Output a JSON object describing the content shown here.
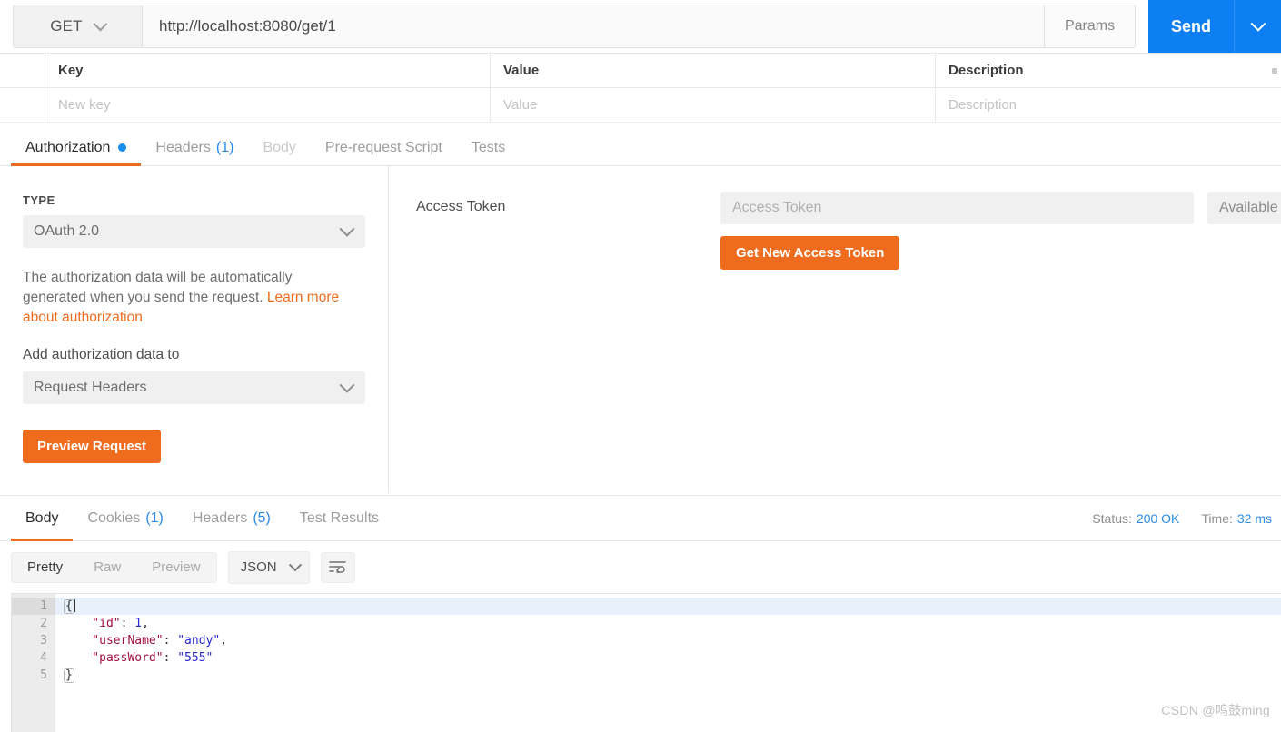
{
  "request": {
    "method": "GET",
    "method_icon": "chevron-down-icon",
    "url": "http://localhost:8080/get/1",
    "params_label": "Params",
    "send_label": "Send",
    "send_caret_icon": "chevron-down-icon"
  },
  "params_table": {
    "headers": [
      "Key",
      "Value",
      "Description"
    ],
    "bulk_icon": "ellipsis-icon",
    "rows": [
      {
        "key": "New key",
        "value": "Value",
        "description": "Description"
      }
    ]
  },
  "request_tabs": [
    {
      "label": "Authorization",
      "active": true,
      "dot": true
    },
    {
      "label": "Headers",
      "count": "(1)",
      "active": false
    },
    {
      "label": "Body",
      "active": false,
      "dim": true
    },
    {
      "label": "Pre-request Script",
      "active": false
    },
    {
      "label": "Tests",
      "active": false
    }
  ],
  "authorization": {
    "type_label": "TYPE",
    "type_value": "OAuth 2.0",
    "type_caret_icon": "chevron-down-icon",
    "help_text": "The authorization data will be automatically generated when you send the request. ",
    "help_link": "Learn more about authorization",
    "add_data_label": "Add authorization data to",
    "add_data_value": "Request Headers",
    "add_data_caret_icon": "chevron-down-icon",
    "preview_button": "Preview Request",
    "access_token_label": "Access Token",
    "access_token_placeholder": "Access Token",
    "access_token_value": "",
    "available_tokens_label": "Available Tokens",
    "get_token_button": "Get New Access Token"
  },
  "response": {
    "tabs": [
      {
        "label": "Body",
        "active": true
      },
      {
        "label": "Cookies",
        "count": "(1)",
        "active": false
      },
      {
        "label": "Headers",
        "count": "(5)",
        "active": false
      },
      {
        "label": "Test Results",
        "active": false
      }
    ],
    "status_label": "Status:",
    "status_value": "200 OK",
    "time_label": "Time:",
    "time_value": "32 ms",
    "view_modes": [
      {
        "label": "Pretty",
        "active": true
      },
      {
        "label": "Raw",
        "active": false
      },
      {
        "label": "Preview",
        "active": false
      }
    ],
    "format": "JSON",
    "format_caret_icon": "chevron-down-icon",
    "wrap_icon": "word-wrap-icon",
    "line_numbers": [
      "1",
      "2",
      "3",
      "4",
      "5"
    ],
    "body_lines": [
      {
        "raw": "{",
        "tokens": [
          {
            "t": "punct",
            "v": "{"
          }
        ]
      },
      {
        "raw": "    \"id\": 1,",
        "tokens": [
          {
            "t": "key",
            "v": "    \"id\""
          },
          {
            "t": "punct",
            "v": ": "
          },
          {
            "t": "num",
            "v": "1"
          },
          {
            "t": "punct",
            "v": ","
          }
        ]
      },
      {
        "raw": "    \"userName\": \"andy\",",
        "tokens": [
          {
            "t": "key",
            "v": "    \"userName\""
          },
          {
            "t": "punct",
            "v": ": "
          },
          {
            "t": "str",
            "v": "\"andy\""
          },
          {
            "t": "punct",
            "v": ","
          }
        ]
      },
      {
        "raw": "    \"passWord\": \"555\"",
        "tokens": [
          {
            "t": "key",
            "v": "    \"passWord\""
          },
          {
            "t": "punct",
            "v": ": "
          },
          {
            "t": "str",
            "v": "\"555\""
          }
        ]
      },
      {
        "raw": "}",
        "tokens": [
          {
            "t": "punct",
            "v": "}"
          }
        ]
      }
    ]
  },
  "watermark": "CSDN @鸣鼓ming",
  "colors": {
    "accent_orange": "#ef6c1f",
    "send_blue": "#0d7ff2",
    "link_blue": "#2b8ae6",
    "json_key": "#a11043",
    "json_value": "#2a2ad0"
  }
}
